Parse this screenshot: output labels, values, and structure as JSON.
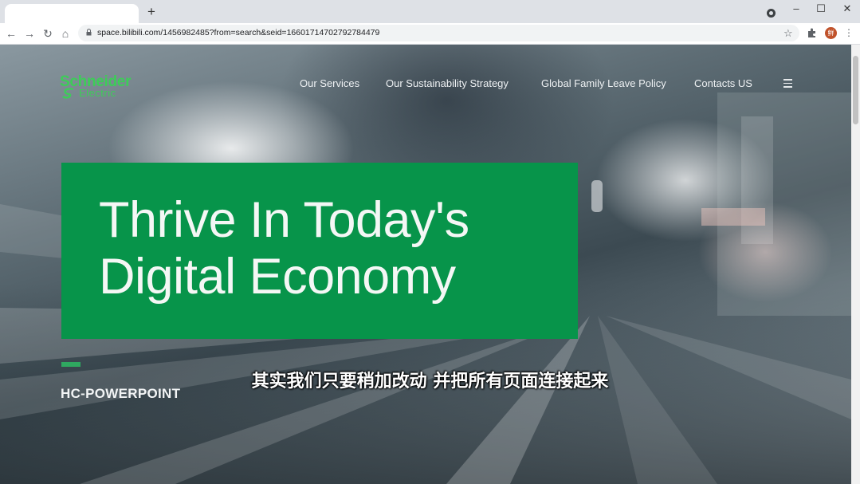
{
  "browser": {
    "new_tab_symbol": "+",
    "url": "space.bilibili.com/1456982485?from=search&seid=16601714702792784479",
    "window_controls": {
      "minimize": "–",
      "maximize": "☐",
      "close": "✕"
    },
    "nav_symbols": {
      "back": "←",
      "forward": "→",
      "reload": "↻",
      "home": "⌂"
    },
    "bookmark_symbol": "☆",
    "menu_symbol": "⋮",
    "avatar_letter": "鲜"
  },
  "site": {
    "logo": {
      "line1": "Schneider",
      "line2": "Electric",
      "color": "#3dcd58"
    },
    "nav": [
      {
        "label": "Our Services"
      },
      {
        "label": "Our Sustainability Strategy"
      },
      {
        "label": "Global Family Leave Policy"
      },
      {
        "label": "Contacts US"
      }
    ],
    "hero": {
      "line1": "Thrive In Today's",
      "line2": "Digital Economy",
      "box_color": "#07944a"
    },
    "brand_caption": "HC-POWERPOINT"
  },
  "video_subtitle": "其实我们只要稍加改动 并把所有页面连接起来"
}
